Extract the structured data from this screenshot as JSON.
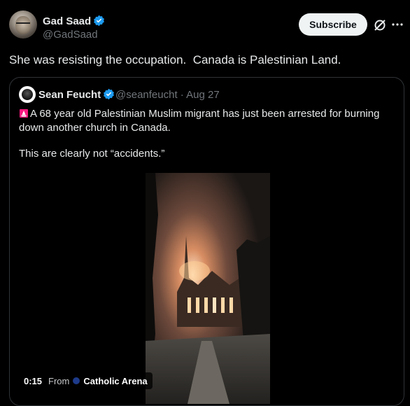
{
  "post": {
    "author_name": "Gad Saad",
    "author_handle": "@GadSaad",
    "subscribe_label": "Subscribe",
    "text": "She was resisting the occupation.  Canada is Palestinian Land."
  },
  "quote": {
    "author_name": "Sean Feucht",
    "meta": "@seanfeucht · Aug 27",
    "text_line1": "A 68 year old Palestinian Muslim migrant has just been arrested for burning down another church in Canada.",
    "text_line2": "This are clearly not “accidents.”",
    "video": {
      "time": "0:15",
      "from_label": "From",
      "source": "Catholic Arena"
    }
  },
  "icons": {
    "verified": "verified-badge-icon",
    "grok": "grok-icon",
    "more": "more-icon",
    "siren": "siren-icon"
  },
  "colors": {
    "verified": "#1d9bf0",
    "background": "#000000",
    "secondary_text": "#71767b",
    "subscribe_bg": "#eff3f4"
  }
}
